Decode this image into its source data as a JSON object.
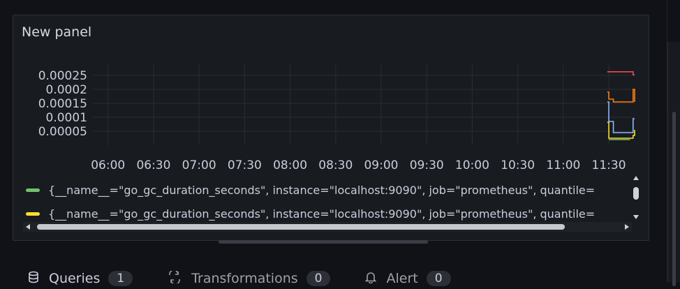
{
  "panel": {
    "title": "New panel"
  },
  "chart_data": {
    "type": "line",
    "title": "New panel",
    "xlabel": "",
    "ylabel": "",
    "y_ticks": [
      "0.00025",
      "0.0002",
      "0.00015",
      "0.0001",
      "0.00005"
    ],
    "x_ticks": [
      "06:00",
      "06:30",
      "07:00",
      "07:30",
      "08:00",
      "08:30",
      "09:00",
      "09:30",
      "10:00",
      "10:30",
      "11:00",
      "11:30"
    ],
    "grid": true,
    "legend_position": "bottom",
    "series": [
      {
        "color": "#73bf69",
        "points": [
          [
            "11:30",
            2e-05
          ],
          [
            "11:32",
            2e-05
          ],
          [
            "11:34",
            2e-05
          ],
          [
            "11:36",
            2e-05
          ],
          [
            "11:38",
            2e-05
          ],
          [
            "11:40",
            2e-05
          ],
          [
            "11:42",
            2e-05
          ],
          [
            "11:44",
            2e-05
          ]
        ]
      },
      {
        "color": "#fade2a",
        "points": [
          [
            "11:29",
            8.2e-05
          ],
          [
            "11:30",
            2.5e-05
          ],
          [
            "11:32",
            2.5e-05
          ],
          [
            "11:34",
            2.5e-05
          ],
          [
            "11:36",
            2.5e-05
          ],
          [
            "11:38",
            2.5e-05
          ],
          [
            "11:40",
            2.5e-05
          ],
          [
            "11:42",
            2.5e-05
          ],
          [
            "11:44",
            2.5e-05
          ],
          [
            "11:46",
            3.5e-05
          ],
          [
            "11:47",
            3.5e-05
          ],
          [
            "11:47",
            5.5e-05
          ]
        ]
      },
      {
        "color": "#8ab8ff",
        "points": [
          [
            "11:29",
            0.000155
          ],
          [
            "11:30",
            8.5e-05
          ],
          [
            "11:32",
            8.5e-05
          ],
          [
            "11:33",
            4.5e-05
          ],
          [
            "11:35",
            4.5e-05
          ],
          [
            "11:37",
            4.5e-05
          ],
          [
            "11:39",
            4.5e-05
          ],
          [
            "11:41",
            4.5e-05
          ],
          [
            "11:43",
            4.5e-05
          ],
          [
            "11:46",
            9.5e-05
          ],
          [
            "11:47",
            9.5e-05
          ]
        ]
      },
      {
        "color": "#ff7f0e",
        "points": [
          [
            "11:29",
            0.00019
          ],
          [
            "11:30",
            0.000165
          ],
          [
            "11:32",
            0.000165
          ],
          [
            "11:33",
            0.000165
          ],
          [
            "11:33",
            0.000155
          ],
          [
            "11:35",
            0.000155
          ],
          [
            "11:37",
            0.000155
          ],
          [
            "11:39",
            0.000155
          ],
          [
            "11:41",
            0.000155
          ],
          [
            "11:43",
            0.000155
          ],
          [
            "11:46",
            0.0002
          ],
          [
            "11:47",
            0.0002
          ],
          [
            "11:47",
            0.000155
          ]
        ]
      },
      {
        "color": "#f2495c",
        "points": [
          [
            "11:29",
            0.000263
          ],
          [
            "11:31",
            0.000263
          ],
          [
            "11:34",
            0.000263
          ],
          [
            "11:37",
            0.000263
          ],
          [
            "11:40",
            0.000263
          ],
          [
            "11:43",
            0.000263
          ],
          [
            "11:46",
            0.000252
          ],
          [
            "11:47",
            0.000252
          ]
        ]
      }
    ]
  },
  "legend": [
    {
      "color": "#73bf69",
      "text": "{__name__=\"go_gc_duration_seconds\", instance=\"localhost:9090\", job=\"prometheus\", quantile="
    },
    {
      "color": "#fade2a",
      "text": "{__name__=\"go_gc_duration_seconds\", instance=\"localhost:9090\", job=\"prometheus\", quantile="
    }
  ],
  "tabs": [
    {
      "label": "Queries",
      "count": "1",
      "icon": "database-icon"
    },
    {
      "label": "Transformations",
      "count": "0",
      "icon": "transform-icon"
    },
    {
      "label": "Alert",
      "count": "0",
      "icon": "bell-icon"
    }
  ]
}
